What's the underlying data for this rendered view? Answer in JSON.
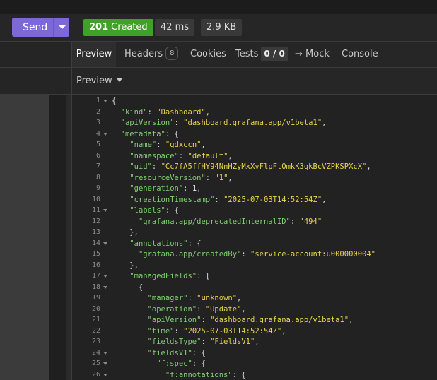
{
  "toolbar": {
    "send_label": "Send",
    "status_code": "201",
    "status_text": "Created",
    "time": "42 ms",
    "size": "2.9 KB",
    "colors": {
      "send": "#7c68d6",
      "status_ok": "#3fa128"
    }
  },
  "tabs": {
    "preview": "Preview",
    "headers": "Headers",
    "headers_count": "8",
    "cookies": "Cookies",
    "tests": "Tests",
    "tests_count": "0 / 0",
    "mock": "→ Mock",
    "console": "Console"
  },
  "subbar": {
    "preview_mode": "Preview"
  },
  "code_lines": [
    {
      "n": "1",
      "fold": true,
      "parts": [
        [
          "p",
          "{"
        ]
      ]
    },
    {
      "n": "2",
      "fold": false,
      "parts": [
        [
          "p",
          "  "
        ],
        [
          "k",
          "\"kind\""
        ],
        [
          "p",
          ": "
        ],
        [
          "s",
          "\"Dashboard\""
        ],
        [
          "p",
          ","
        ]
      ]
    },
    {
      "n": "3",
      "fold": false,
      "parts": [
        [
          "p",
          "  "
        ],
        [
          "k",
          "\"apiVersion\""
        ],
        [
          "p",
          ": "
        ],
        [
          "s",
          "\"dashboard.grafana.app/v1beta1\""
        ],
        [
          "p",
          ","
        ]
      ]
    },
    {
      "n": "4",
      "fold": true,
      "parts": [
        [
          "p",
          "  "
        ],
        [
          "k",
          "\"metadata\""
        ],
        [
          "p",
          ": {"
        ]
      ]
    },
    {
      "n": "5",
      "fold": false,
      "parts": [
        [
          "p",
          "    "
        ],
        [
          "k",
          "\"name\""
        ],
        [
          "p",
          ": "
        ],
        [
          "s",
          "\"gdxccn\""
        ],
        [
          "p",
          ","
        ]
      ]
    },
    {
      "n": "6",
      "fold": false,
      "parts": [
        [
          "p",
          "    "
        ],
        [
          "k",
          "\"namespace\""
        ],
        [
          "p",
          ": "
        ],
        [
          "s",
          "\"default\""
        ],
        [
          "p",
          ","
        ]
      ]
    },
    {
      "n": "7",
      "fold": false,
      "parts": [
        [
          "p",
          "    "
        ],
        [
          "k",
          "\"uid\""
        ],
        [
          "p",
          ": "
        ],
        [
          "s",
          "\"Cc7fA5ffHY94NnHZyMxXvFlpFtOmkK3qkBcVZPKSPXcX\""
        ],
        [
          "p",
          ","
        ]
      ]
    },
    {
      "n": "8",
      "fold": false,
      "parts": [
        [
          "p",
          "    "
        ],
        [
          "k",
          "\"resourceVersion\""
        ],
        [
          "p",
          ": "
        ],
        [
          "s",
          "\"1\""
        ],
        [
          "p",
          ","
        ]
      ]
    },
    {
      "n": "9",
      "fold": false,
      "parts": [
        [
          "p",
          "    "
        ],
        [
          "k",
          "\"generation\""
        ],
        [
          "p",
          ": "
        ],
        [
          "n",
          "1"
        ],
        [
          "p",
          ","
        ]
      ]
    },
    {
      "n": "10",
      "fold": false,
      "parts": [
        [
          "p",
          "    "
        ],
        [
          "k",
          "\"creationTimestamp\""
        ],
        [
          "p",
          ": "
        ],
        [
          "s",
          "\"2025-07-03T14:52:54Z\""
        ],
        [
          "p",
          ","
        ]
      ]
    },
    {
      "n": "11",
      "fold": true,
      "parts": [
        [
          "p",
          "    "
        ],
        [
          "k",
          "\"labels\""
        ],
        [
          "p",
          ": {"
        ]
      ]
    },
    {
      "n": "12",
      "fold": false,
      "parts": [
        [
          "p",
          "      "
        ],
        [
          "k",
          "\"grafana.app/deprecatedInternalID\""
        ],
        [
          "p",
          ": "
        ],
        [
          "s",
          "\"494\""
        ]
      ]
    },
    {
      "n": "13",
      "fold": false,
      "parts": [
        [
          "p",
          "    },"
        ]
      ]
    },
    {
      "n": "14",
      "fold": true,
      "parts": [
        [
          "p",
          "    "
        ],
        [
          "k",
          "\"annotations\""
        ],
        [
          "p",
          ": {"
        ]
      ]
    },
    {
      "n": "15",
      "fold": false,
      "parts": [
        [
          "p",
          "      "
        ],
        [
          "k",
          "\"grafana.app/createdBy\""
        ],
        [
          "p",
          ": "
        ],
        [
          "s",
          "\"service-account:u000000004\""
        ]
      ]
    },
    {
      "n": "16",
      "fold": false,
      "parts": [
        [
          "p",
          "    },"
        ]
      ]
    },
    {
      "n": "17",
      "fold": true,
      "parts": [
        [
          "p",
          "    "
        ],
        [
          "k",
          "\"managedFields\""
        ],
        [
          "p",
          ": ["
        ]
      ]
    },
    {
      "n": "18",
      "fold": true,
      "parts": [
        [
          "p",
          "      {"
        ]
      ]
    },
    {
      "n": "19",
      "fold": false,
      "parts": [
        [
          "p",
          "        "
        ],
        [
          "k",
          "\"manager\""
        ],
        [
          "p",
          ": "
        ],
        [
          "s",
          "\"unknown\""
        ],
        [
          "p",
          ","
        ]
      ]
    },
    {
      "n": "20",
      "fold": false,
      "parts": [
        [
          "p",
          "        "
        ],
        [
          "k",
          "\"operation\""
        ],
        [
          "p",
          ": "
        ],
        [
          "s",
          "\"Update\""
        ],
        [
          "p",
          ","
        ]
      ]
    },
    {
      "n": "21",
      "fold": false,
      "parts": [
        [
          "p",
          "        "
        ],
        [
          "k",
          "\"apiVersion\""
        ],
        [
          "p",
          ": "
        ],
        [
          "s",
          "\"dashboard.grafana.app/v1beta1\""
        ],
        [
          "p",
          ","
        ]
      ]
    },
    {
      "n": "22",
      "fold": false,
      "parts": [
        [
          "p",
          "        "
        ],
        [
          "k",
          "\"time\""
        ],
        [
          "p",
          ": "
        ],
        [
          "s",
          "\"2025-07-03T14:52:54Z\""
        ],
        [
          "p",
          ","
        ]
      ]
    },
    {
      "n": "23",
      "fold": false,
      "parts": [
        [
          "p",
          "        "
        ],
        [
          "k",
          "\"fieldsType\""
        ],
        [
          "p",
          ": "
        ],
        [
          "s",
          "\"FieldsV1\""
        ],
        [
          "p",
          ","
        ]
      ]
    },
    {
      "n": "24",
      "fold": true,
      "parts": [
        [
          "p",
          "        "
        ],
        [
          "k",
          "\"fieldsV1\""
        ],
        [
          "p",
          ": {"
        ]
      ]
    },
    {
      "n": "25",
      "fold": true,
      "parts": [
        [
          "p",
          "          "
        ],
        [
          "k",
          "\"f:spec\""
        ],
        [
          "p",
          ": {"
        ]
      ]
    },
    {
      "n": "26",
      "fold": true,
      "parts": [
        [
          "p",
          "            "
        ],
        [
          "k",
          "\"f:annotations\""
        ],
        [
          "p",
          ": {"
        ]
      ]
    }
  ]
}
